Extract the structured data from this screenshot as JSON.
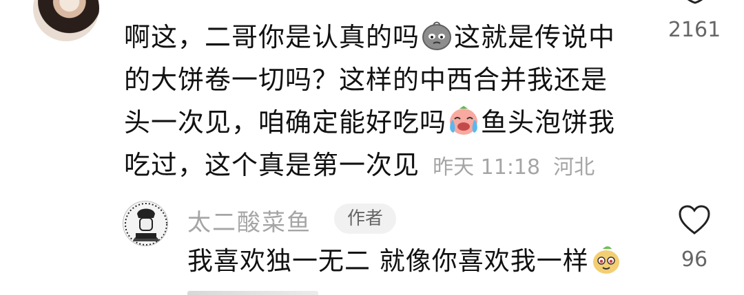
{
  "comment": {
    "part1": "啊这，二哥你是认真的吗",
    "emoji1": "sad-potato-emoji",
    "part2": "这就是传说中的大饼卷一切吗？这样的中西合并我还是头一次见，咱确定能好吃吗",
    "emoji2": "crying-laughing-emoji",
    "part3": "鱼头泡饼我吃过，这个真是第一次见",
    "time": "昨天 11:18",
    "location": "河北",
    "like_count": "2161"
  },
  "reply": {
    "author": "太二酸菜鱼",
    "badge": "作者",
    "text": "我喜欢独一无二 就像你喜欢我一样",
    "emoji": "cute-face-emoji",
    "like_count": "96"
  },
  "colors": {
    "text": "#111111",
    "meta": "#a5a5a5",
    "badge_bg": "#f1f1f1",
    "count": "#666666"
  }
}
